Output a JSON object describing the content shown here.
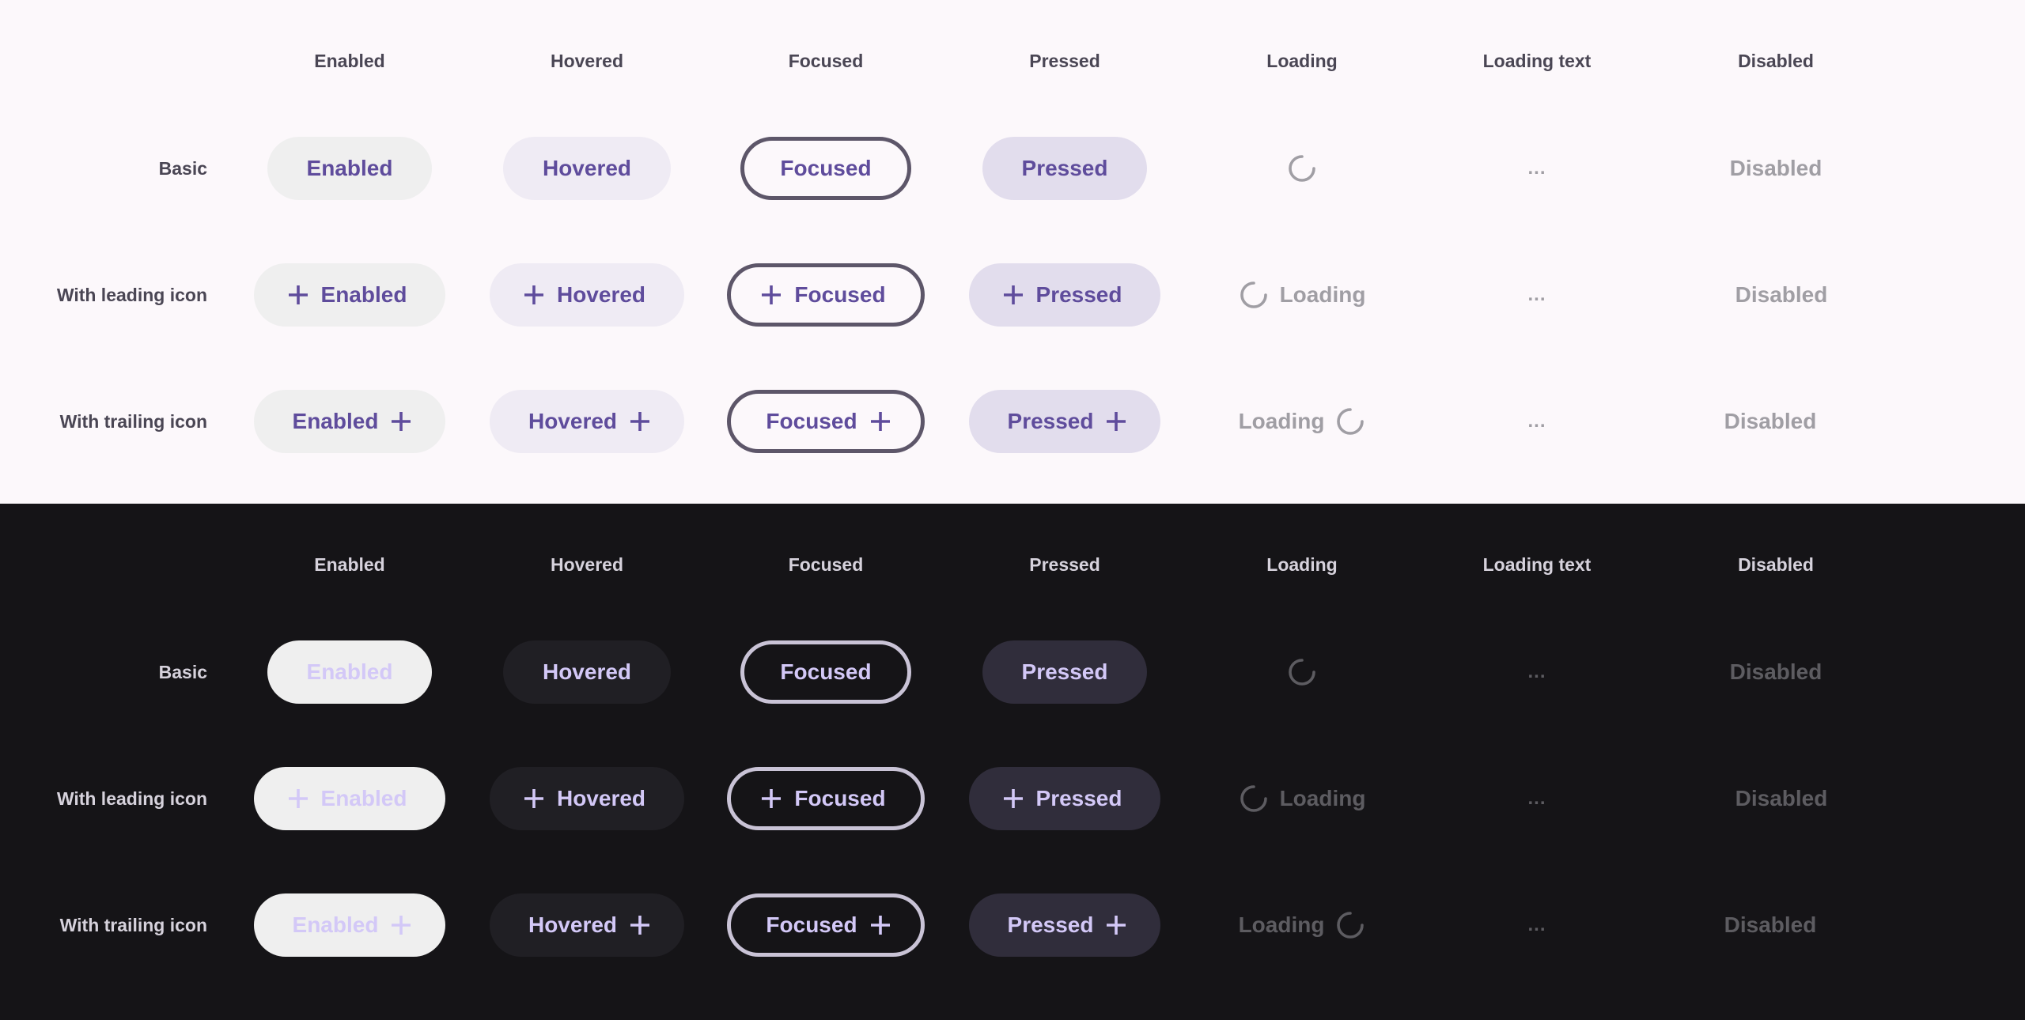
{
  "columns": [
    "Enabled",
    "Hovered",
    "Focused",
    "Pressed",
    "Loading",
    "Loading text",
    "Disabled"
  ],
  "rows": [
    "Basic",
    "With leading icon",
    "With trailing icon"
  ],
  "buttons": {
    "enabled": "Enabled",
    "hovered": "Hovered",
    "focused": "Focused",
    "pressed": "Pressed",
    "loading": "Loading",
    "loading_text": "...",
    "disabled": "Disabled"
  },
  "icons": {
    "add": "plus-icon",
    "spinner": "spinner-icon"
  },
  "themes": {
    "light": {
      "background": "#fcf8fb",
      "accent": "#5f4c9c",
      "hover": "#efebf4",
      "pressed": "#e2dded",
      "focus_ring": "#5d5669",
      "disabled": "#a09ea4"
    },
    "dark": {
      "background": "#151417",
      "accent": "#d3c8f7",
      "hover": "#201f24",
      "pressed": "#302d3b",
      "focus_ring": "#c9c3d6",
      "disabled": "#5d5c61"
    }
  }
}
